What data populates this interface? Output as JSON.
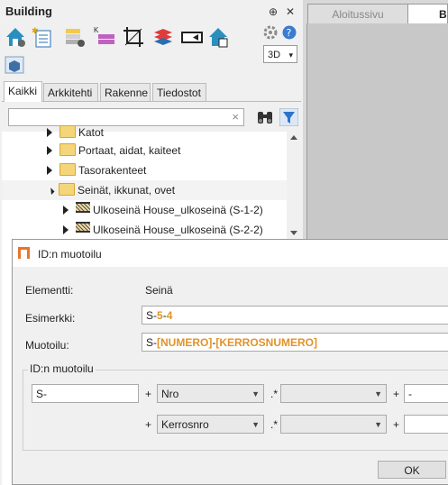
{
  "panel": {
    "title": "Building",
    "pin_glyph": "⊕",
    "close_glyph": "✕",
    "view_select": "3D",
    "view_caret": "▾",
    "tabs": [
      "Kaikki",
      "Arkkitehti",
      "Rakenne",
      "Tiedostot"
    ],
    "search_clear": "×",
    "tree": [
      {
        "label": "Katot",
        "kind": "folder",
        "expanded": false
      },
      {
        "label": "Portaat, aidat, kaiteet",
        "kind": "folder",
        "expanded": false
      },
      {
        "label": "Tasorakenteet",
        "kind": "folder",
        "expanded": false
      },
      {
        "label": "Seinät, ikkunat, ovet",
        "kind": "folder",
        "expanded": true
      },
      {
        "label": "Ulkoseinä House_ulkoseinä (S-1-2)",
        "kind": "wall",
        "expanded": false
      },
      {
        "label": "Ulkoseinä House_ulkoseinä (S-2-2)",
        "kind": "wall",
        "expanded": false
      }
    ]
  },
  "doc_tabs": [
    "Aloitussivu",
    "Bu"
  ],
  "dialog": {
    "title": "ID:n muotoilu",
    "element_label": "Elementti:",
    "element_value": "Seinä",
    "example_label": "Esimerkki:",
    "example_parts": [
      "S-",
      "5",
      "-",
      "4"
    ],
    "format_label": "Muotoilu:",
    "format_parts": [
      "S-",
      "[NUMERO]",
      "-",
      "[KERROSNUMERO]"
    ],
    "group_title": "ID:n muotoilu",
    "row1": {
      "prefix": "S-",
      "plus1": "+",
      "select1": "Nro",
      "dot1": ".*",
      "select2": "",
      "plus2": "+",
      "suffix": "-"
    },
    "row2": {
      "plus1": "+",
      "select1": "Kerrosnro",
      "dot1": ".*",
      "select2": "",
      "plus2": "+",
      "suffix": ""
    },
    "ok_label": "OK"
  },
  "colors": {
    "accent_orange": "#e0932a",
    "folder": "#f5d57a",
    "filter_blue": "#2f73c9"
  }
}
